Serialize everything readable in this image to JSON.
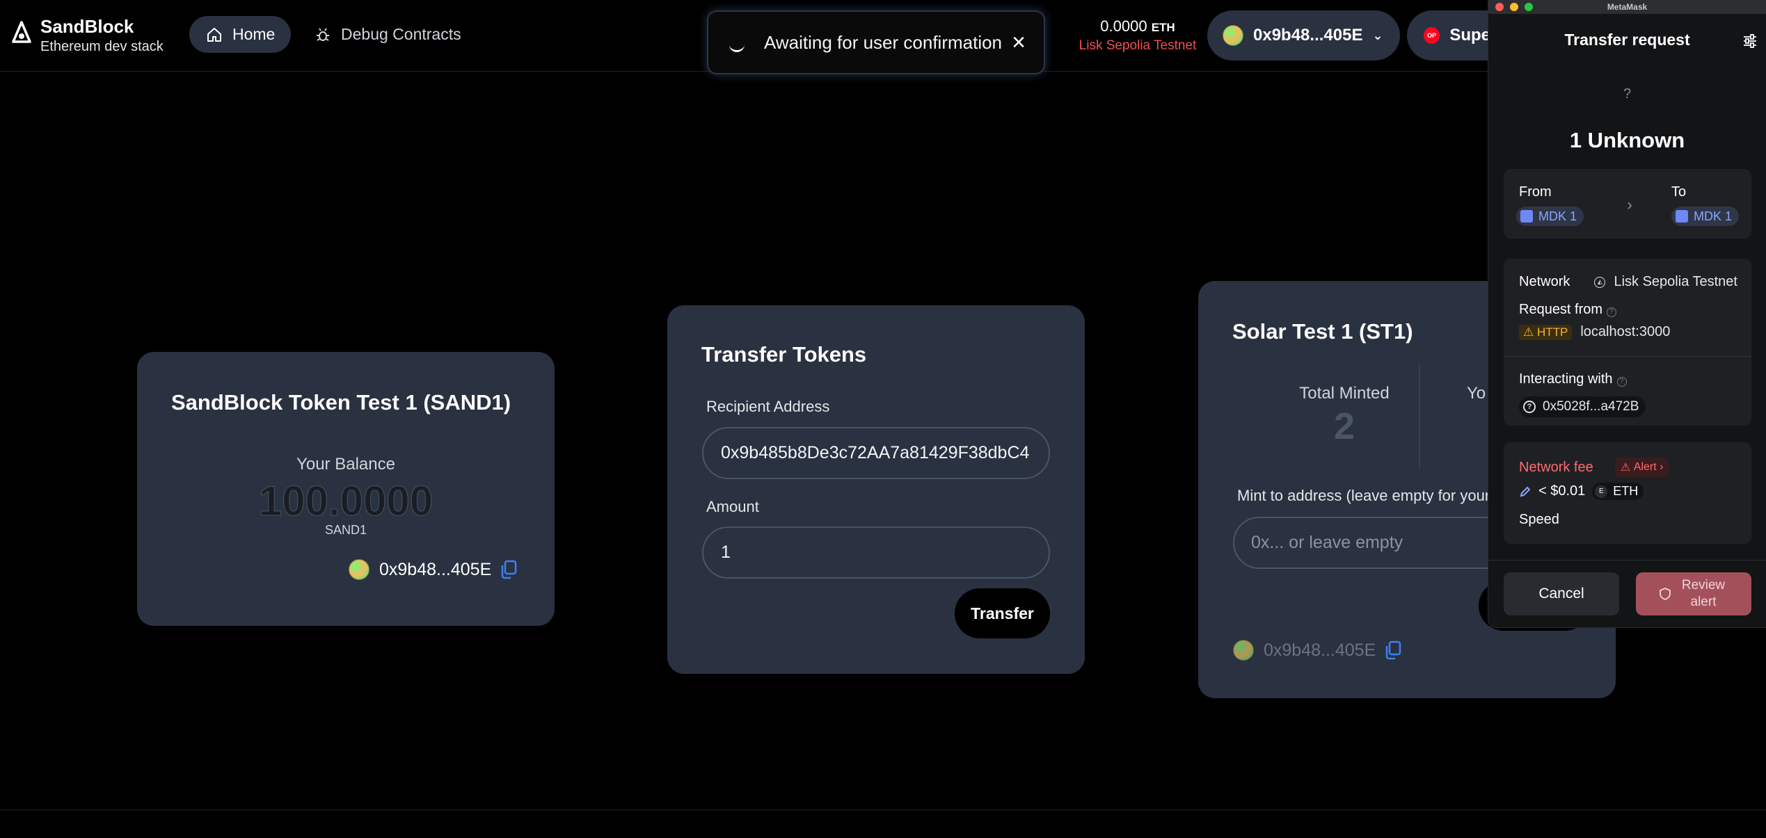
{
  "header": {
    "brand_title": "SandBlock",
    "brand_subtitle": "Ethereum dev stack",
    "nav_home": "Home",
    "nav_debug": "Debug Contracts",
    "toast_text": "Awaiting for user confirmation",
    "balance_value": "0.0000",
    "balance_unit": "ETH",
    "network": "Lisk Sepolia Testnet",
    "account": "0x9b48...405E",
    "super_label": "Supe",
    "op_badge": "OP"
  },
  "card1": {
    "title": "SandBlock Token Test 1 (SAND1)",
    "balance_label": "Your Balance",
    "balance_value": "100.0000",
    "balance_unit": "SAND1",
    "address": "0x9b48...405E"
  },
  "card2": {
    "title": "Transfer Tokens",
    "recipient_label": "Recipient Address",
    "recipient_value": "0x9b485b8De3c72AA7a81429F38dbC4",
    "amount_label": "Amount",
    "amount_value": "1",
    "button": "Transfer"
  },
  "card3": {
    "title": "Solar Test 1 (ST1)",
    "total_minted_label": "Total Minted",
    "total_minted_value": "2",
    "your_label_partial": "Yo",
    "mint_label": "Mint to address (leave empty for your",
    "mint_placeholder": "0x... or leave empty",
    "address": "0x9b48...405E"
  },
  "metamask": {
    "window_title": "MetaMask",
    "title": "Transfer request",
    "unknown_icon": "?",
    "asset": "1 Unknown",
    "from_label": "From",
    "to_label": "To",
    "from_account": "MDK 1",
    "to_account": "MDK 1",
    "network_label": "Network",
    "network_value": "Lisk Sepolia Testnet",
    "request_from_label": "Request from",
    "http_badge": "HTTP",
    "request_from_value": "localhost:3000",
    "interacting_label": "Interacting with",
    "interacting_value": "0x5028f...a472B",
    "fee_label": "Network fee",
    "fee_alert": "Alert",
    "fee_value": "< $0.01",
    "fee_token": "ETH",
    "speed_label": "Speed",
    "cancel": "Cancel",
    "review": "Review alert"
  },
  "colors": {
    "background": "#000000",
    "card": "#2a3140",
    "network_red": "#f05252",
    "metamask_bg": "#131416",
    "alert_red": "#ff6b6b",
    "review_button": "#a4505a"
  }
}
